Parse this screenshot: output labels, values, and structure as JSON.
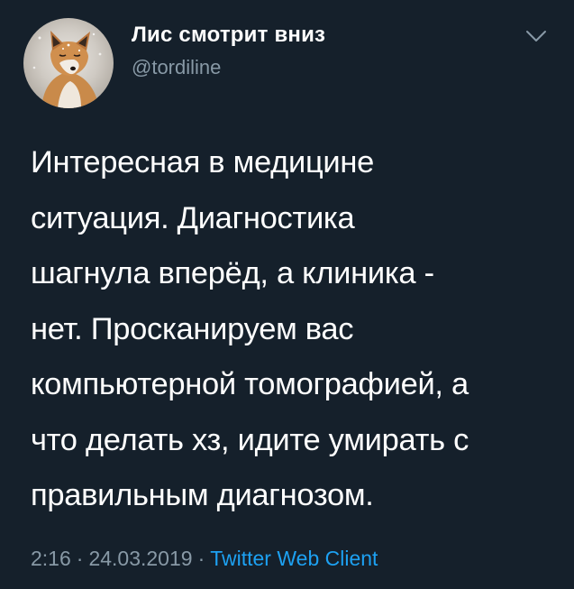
{
  "author": {
    "display_name": "Лис смотрит вниз",
    "handle": "@tordiline"
  },
  "tweet": {
    "lines": [
      "Интересная в медицине",
      "ситуация. Диагностика",
      "шагнула вперёд, а клиника -",
      "нет. Просканируем вас",
      "компьютерной томографией, а",
      "что делать хз, идите умирать с",
      "правильным диагнозом."
    ]
  },
  "meta": {
    "time": "2:16",
    "separator": "·",
    "date": "24.03.2019",
    "client": "Twitter Web Client"
  },
  "icons": {
    "avatar": "fox-avatar",
    "menu": "chevron-down-icon"
  },
  "colors": {
    "background": "#15202b",
    "text": "#ffffff",
    "secondary": "#8899a6",
    "link": "#1da1f2"
  }
}
